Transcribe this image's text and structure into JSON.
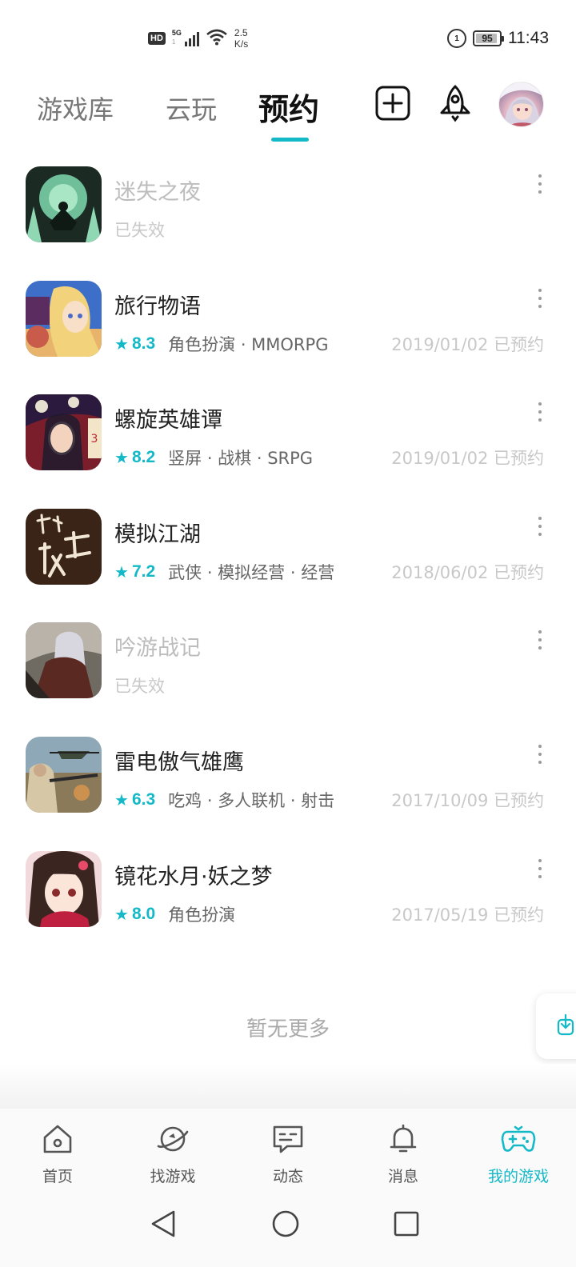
{
  "status_bar": {
    "hd": "HD",
    "network_gen": "5G",
    "speed_value": "2.5",
    "speed_unit": "K/s",
    "battery": "95",
    "time": "11:43"
  },
  "tabs": [
    {
      "label": "游戏库",
      "active": false
    },
    {
      "label": "云玩",
      "active": false
    },
    {
      "label": "预约",
      "active": true
    }
  ],
  "header_icons": [
    "add-square-icon",
    "rocket-icon",
    "avatar"
  ],
  "games": [
    {
      "title": "迷失之夜",
      "valid": false,
      "status": "已失效",
      "rating": "",
      "tags": "",
      "reserved": ""
    },
    {
      "title": "旅行物语",
      "valid": true,
      "status": "",
      "rating": "8.3",
      "tags": "角色扮演 · MMORPG",
      "reserved": "2019/01/02 已预约"
    },
    {
      "title": "螺旋英雄谭",
      "valid": true,
      "status": "",
      "rating": "8.2",
      "tags": "竖屏 · 战棋 · SRPG",
      "reserved": "2019/01/02 已预约"
    },
    {
      "title": "模拟江湖",
      "valid": true,
      "status": "",
      "rating": "7.2",
      "tags": "武侠 · 模拟经营 · 经营",
      "reserved": "2018/06/02 已预约"
    },
    {
      "title": "吟游战记",
      "valid": false,
      "status": "已失效",
      "rating": "",
      "tags": "",
      "reserved": ""
    },
    {
      "title": "雷电傲气雄鹰",
      "valid": true,
      "status": "",
      "rating": "6.3",
      "tags": "吃鸡 · 多人联机 · 射击",
      "reserved": "2017/10/09 已预约"
    },
    {
      "title": "镜花水月·妖之梦",
      "valid": true,
      "status": "",
      "rating": "8.0",
      "tags": "角色扮演",
      "reserved": "2017/05/19 已预约"
    }
  ],
  "no_more_text": "暂无更多",
  "bottom_nav": [
    {
      "label": "首页",
      "icon": "home-icon",
      "active": false
    },
    {
      "label": "找游戏",
      "icon": "planet-icon",
      "active": false
    },
    {
      "label": "动态",
      "icon": "chat-icon",
      "active": false
    },
    {
      "label": "消息",
      "icon": "bell-icon",
      "active": false
    },
    {
      "label": "我的游戏",
      "icon": "gamepad-icon",
      "active": true
    }
  ],
  "colors": {
    "accent": "#14b9c8",
    "invalid": "#bdbdbd"
  }
}
